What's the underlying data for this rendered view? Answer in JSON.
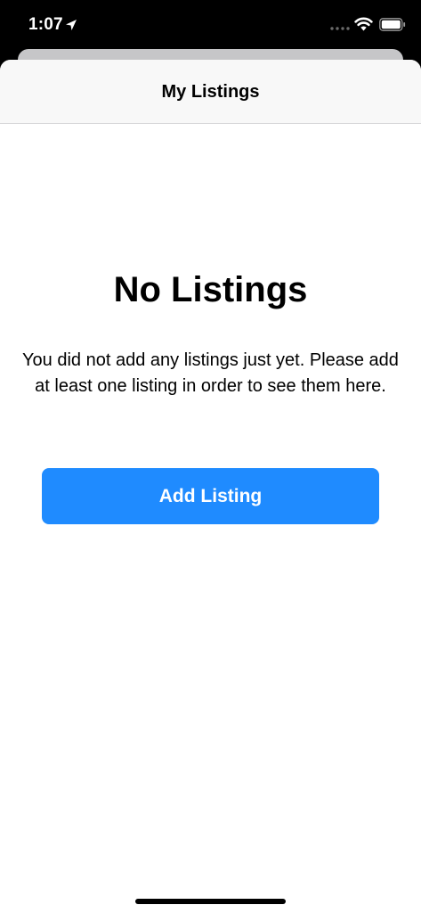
{
  "status_bar": {
    "time": "1:07",
    "icons": [
      "location-arrow-icon",
      "cellular-signal-icon",
      "wifi-icon",
      "battery-icon"
    ]
  },
  "nav": {
    "title": "My Listings"
  },
  "empty_state": {
    "title": "No Listings",
    "message": "You did not add any listings just yet. Please add at least one listing in order to see them here.",
    "button_label": "Add Listing"
  },
  "colors": {
    "accent": "#1F8BFF",
    "nav_background": "#F8F8F8",
    "background": "#FFFFFF"
  }
}
